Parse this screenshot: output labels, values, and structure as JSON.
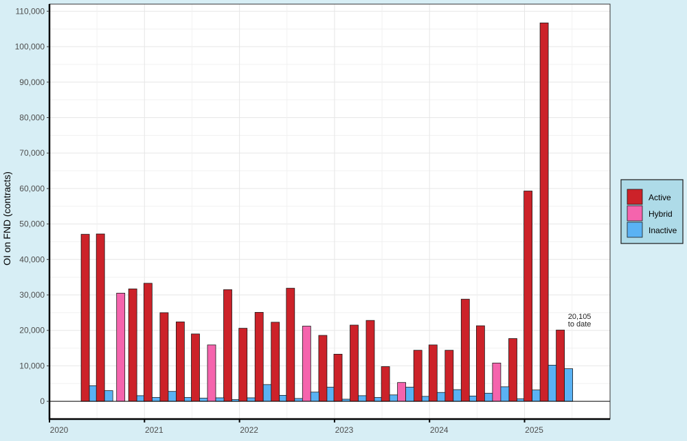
{
  "chart_data": {
    "type": "bar",
    "title": "",
    "xlabel": "",
    "ylabel": "OI on FND (contracts)",
    "ylim": [
      -5000,
      112000
    ],
    "y_ticks": [
      0,
      10000,
      20000,
      30000,
      40000,
      50000,
      60000,
      70000,
      80000,
      90000,
      100000,
      110000
    ],
    "y_tick_labels": [
      "0",
      "10,000",
      "20,000",
      "30,000",
      "40,000",
      "50,000",
      "60,000",
      "70,000",
      "80,000",
      "90,000",
      "100,000",
      "110,000"
    ],
    "x_tick_labels": [
      "2020",
      "2021",
      "2022",
      "2023",
      "2024",
      "2025"
    ],
    "x_range_years": [
      2020.0,
      2025.9
    ],
    "grid": true,
    "legend_position": "right",
    "colors": {
      "Active": "#cc2229",
      "Hybrid": "#f564ad",
      "Inactive": "#5ab2f4"
    },
    "series": [
      {
        "name": "Active",
        "color": "#cc2229",
        "points": [
          {
            "x": 2020.42,
            "y": 47100
          },
          {
            "x": 2020.58,
            "y": 47200
          },
          {
            "x": 2020.92,
            "y": 31700
          },
          {
            "x": 2021.08,
            "y": 33300
          },
          {
            "x": 2021.25,
            "y": 25000
          },
          {
            "x": 2021.42,
            "y": 22400
          },
          {
            "x": 2021.58,
            "y": 19000
          },
          {
            "x": 2021.92,
            "y": 31500
          },
          {
            "x": 2022.08,
            "y": 20600
          },
          {
            "x": 2022.25,
            "y": 25100
          },
          {
            "x": 2022.42,
            "y": 22300
          },
          {
            "x": 2022.58,
            "y": 31900
          },
          {
            "x": 2022.92,
            "y": 18600
          },
          {
            "x": 2023.08,
            "y": 13300
          },
          {
            "x": 2023.25,
            "y": 21500
          },
          {
            "x": 2023.42,
            "y": 22800
          },
          {
            "x": 2023.58,
            "y": 9800
          },
          {
            "x": 2023.92,
            "y": 14400
          },
          {
            "x": 2024.08,
            "y": 15900
          },
          {
            "x": 2024.25,
            "y": 14400
          },
          {
            "x": 2024.42,
            "y": 28800
          },
          {
            "x": 2024.58,
            "y": 21300
          },
          {
            "x": 2024.92,
            "y": 17700
          },
          {
            "x": 2025.08,
            "y": 59300
          },
          {
            "x": 2025.25,
            "y": 106700
          },
          {
            "x": 2025.42,
            "y": 20105
          }
        ]
      },
      {
        "name": "Hybrid",
        "color": "#f564ad",
        "points": [
          {
            "x": 2020.75,
            "y": 30500
          },
          {
            "x": 2021.75,
            "y": 15900
          },
          {
            "x": 2022.75,
            "y": 21200
          },
          {
            "x": 2023.75,
            "y": 5300
          },
          {
            "x": 2024.75,
            "y": 10800
          }
        ]
      },
      {
        "name": "Inactive",
        "color": "#5ab2f4",
        "points": [
          {
            "x": 2020.42,
            "y": 4400
          },
          {
            "x": 2020.58,
            "y": 3000
          },
          {
            "x": 2020.92,
            "y": 1600
          },
          {
            "x": 2021.08,
            "y": 1100
          },
          {
            "x": 2021.25,
            "y": 2800
          },
          {
            "x": 2021.42,
            "y": 1100
          },
          {
            "x": 2021.58,
            "y": 900
          },
          {
            "x": 2021.75,
            "y": 1000
          },
          {
            "x": 2021.92,
            "y": 500
          },
          {
            "x": 2022.08,
            "y": 1000
          },
          {
            "x": 2022.25,
            "y": 4700
          },
          {
            "x": 2022.42,
            "y": 1700
          },
          {
            "x": 2022.58,
            "y": 800
          },
          {
            "x": 2022.75,
            "y": 2600
          },
          {
            "x": 2022.92,
            "y": 4000
          },
          {
            "x": 2023.08,
            "y": 600
          },
          {
            "x": 2023.25,
            "y": 1600
          },
          {
            "x": 2023.42,
            "y": 1100
          },
          {
            "x": 2023.58,
            "y": 1800
          },
          {
            "x": 2023.75,
            "y": 4000
          },
          {
            "x": 2023.92,
            "y": 1400
          },
          {
            "x": 2024.08,
            "y": 2500
          },
          {
            "x": 2024.25,
            "y": 3300
          },
          {
            "x": 2024.42,
            "y": 1500
          },
          {
            "x": 2024.58,
            "y": 2300
          },
          {
            "x": 2024.75,
            "y": 4100
          },
          {
            "x": 2024.92,
            "y": 700
          },
          {
            "x": 2025.08,
            "y": 3200
          },
          {
            "x": 2025.25,
            "y": 10200
          },
          {
            "x": 2025.42,
            "y": 9200
          }
        ]
      }
    ],
    "annotations": [
      {
        "text_lines": [
          "20,105",
          "to date"
        ],
        "x": 2025.42,
        "y": 20105
      }
    ]
  }
}
